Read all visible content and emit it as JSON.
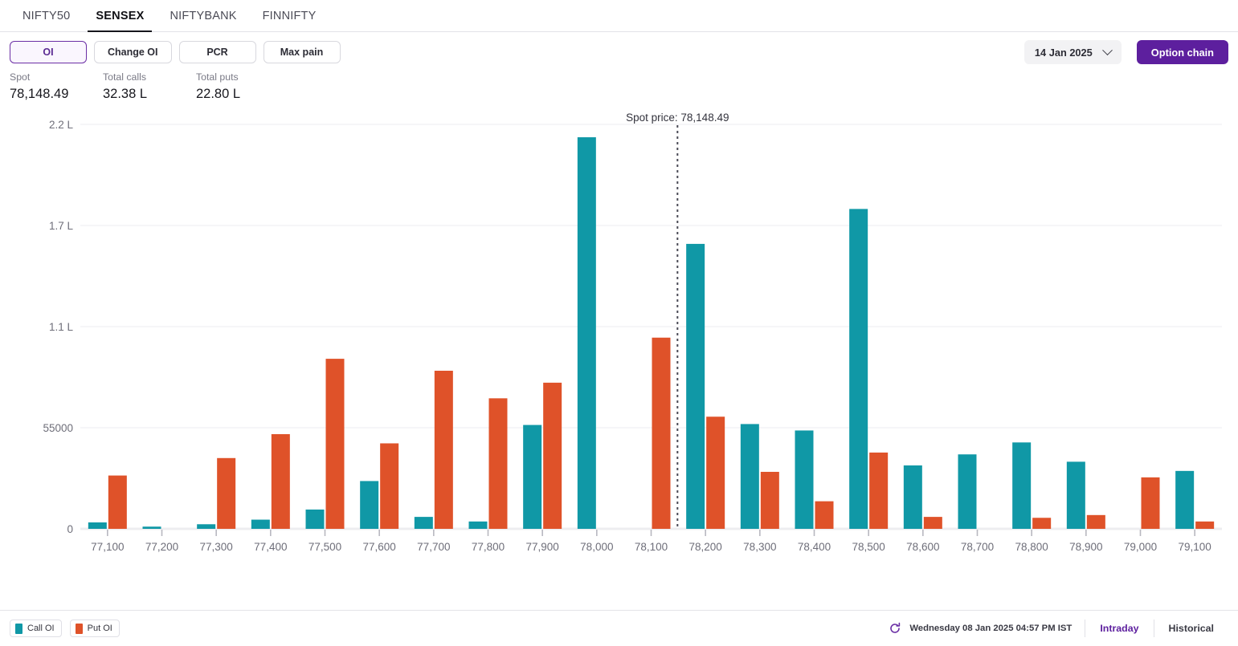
{
  "tabs": [
    {
      "label": "NIFTY50",
      "active": false
    },
    {
      "label": "SENSEX",
      "active": true
    },
    {
      "label": "NIFTYBANK",
      "active": false
    },
    {
      "label": "FINNIFTY",
      "active": false
    }
  ],
  "toolbar": {
    "modes": [
      {
        "label": "OI",
        "selected": true
      },
      {
        "label": "Change OI",
        "selected": false
      },
      {
        "label": "PCR",
        "selected": false
      },
      {
        "label": "Max pain",
        "selected": false
      }
    ],
    "expiry_value": "14 Jan 2025",
    "chevron_icon": "chevron-down-icon",
    "option_chain_label": "Option chain"
  },
  "stats": [
    {
      "label": "Spot",
      "value": "78,148.49"
    },
    {
      "label": "Total calls",
      "value": "32.38 L"
    },
    {
      "label": "Total puts",
      "value": "22.80 L"
    }
  ],
  "footer": {
    "legend": [
      {
        "label": "Call OI",
        "color": "#1098a6"
      },
      {
        "label": "Put OI",
        "color": "#df5229"
      }
    ],
    "refresh_icon": "refresh-icon",
    "timestamp": "Wednesday 08 Jan 2025 04:57 PM IST",
    "links": [
      {
        "label": "Intraday",
        "active": true
      },
      {
        "label": "Historical",
        "active": false
      }
    ]
  },
  "chart_data": {
    "type": "bar",
    "title": "",
    "xlabel": "",
    "ylabel": "",
    "grid": true,
    "legend_position": "bottom-left",
    "ylim": [
      0,
      233000
    ],
    "ytick_values": [
      0,
      55000,
      110000,
      165000,
      220000
    ],
    "ytick_labels": [
      "0",
      "55000",
      "1.1 L",
      "1.7 L",
      "2.2 L"
    ],
    "categories": [
      "77,100",
      "77,200",
      "77,300",
      "77,400",
      "77,500",
      "77,600",
      "77,700",
      "77,800",
      "77,900",
      "78,000",
      "78,100",
      "78,200",
      "78,300",
      "78,400",
      "78,500",
      "78,600",
      "78,700",
      "78,800",
      "78,900",
      "79,000",
      "79,100"
    ],
    "series": [
      {
        "name": "Call OI",
        "color": "#1098a6",
        "values": [
          3500,
          1200,
          2500,
          5000,
          10500,
          26000,
          6500,
          4000,
          56500,
          213000,
          0,
          155000,
          57000,
          53500,
          174000,
          34500,
          40500,
          47000,
          36500,
          0,
          31500
        ]
      },
      {
        "name": "Put OI",
        "color": "#df5229",
        "values": [
          29000,
          0,
          38500,
          51500,
          92500,
          46500,
          86000,
          71000,
          79500,
          0,
          104000,
          61000,
          31000,
          15000,
          41500,
          6500,
          0,
          6000,
          7500,
          28000,
          4000
        ]
      }
    ],
    "annotation": {
      "label": "Spot price: 78,148.49",
      "x_value": 78148.49,
      "line_style": "dotted"
    }
  }
}
